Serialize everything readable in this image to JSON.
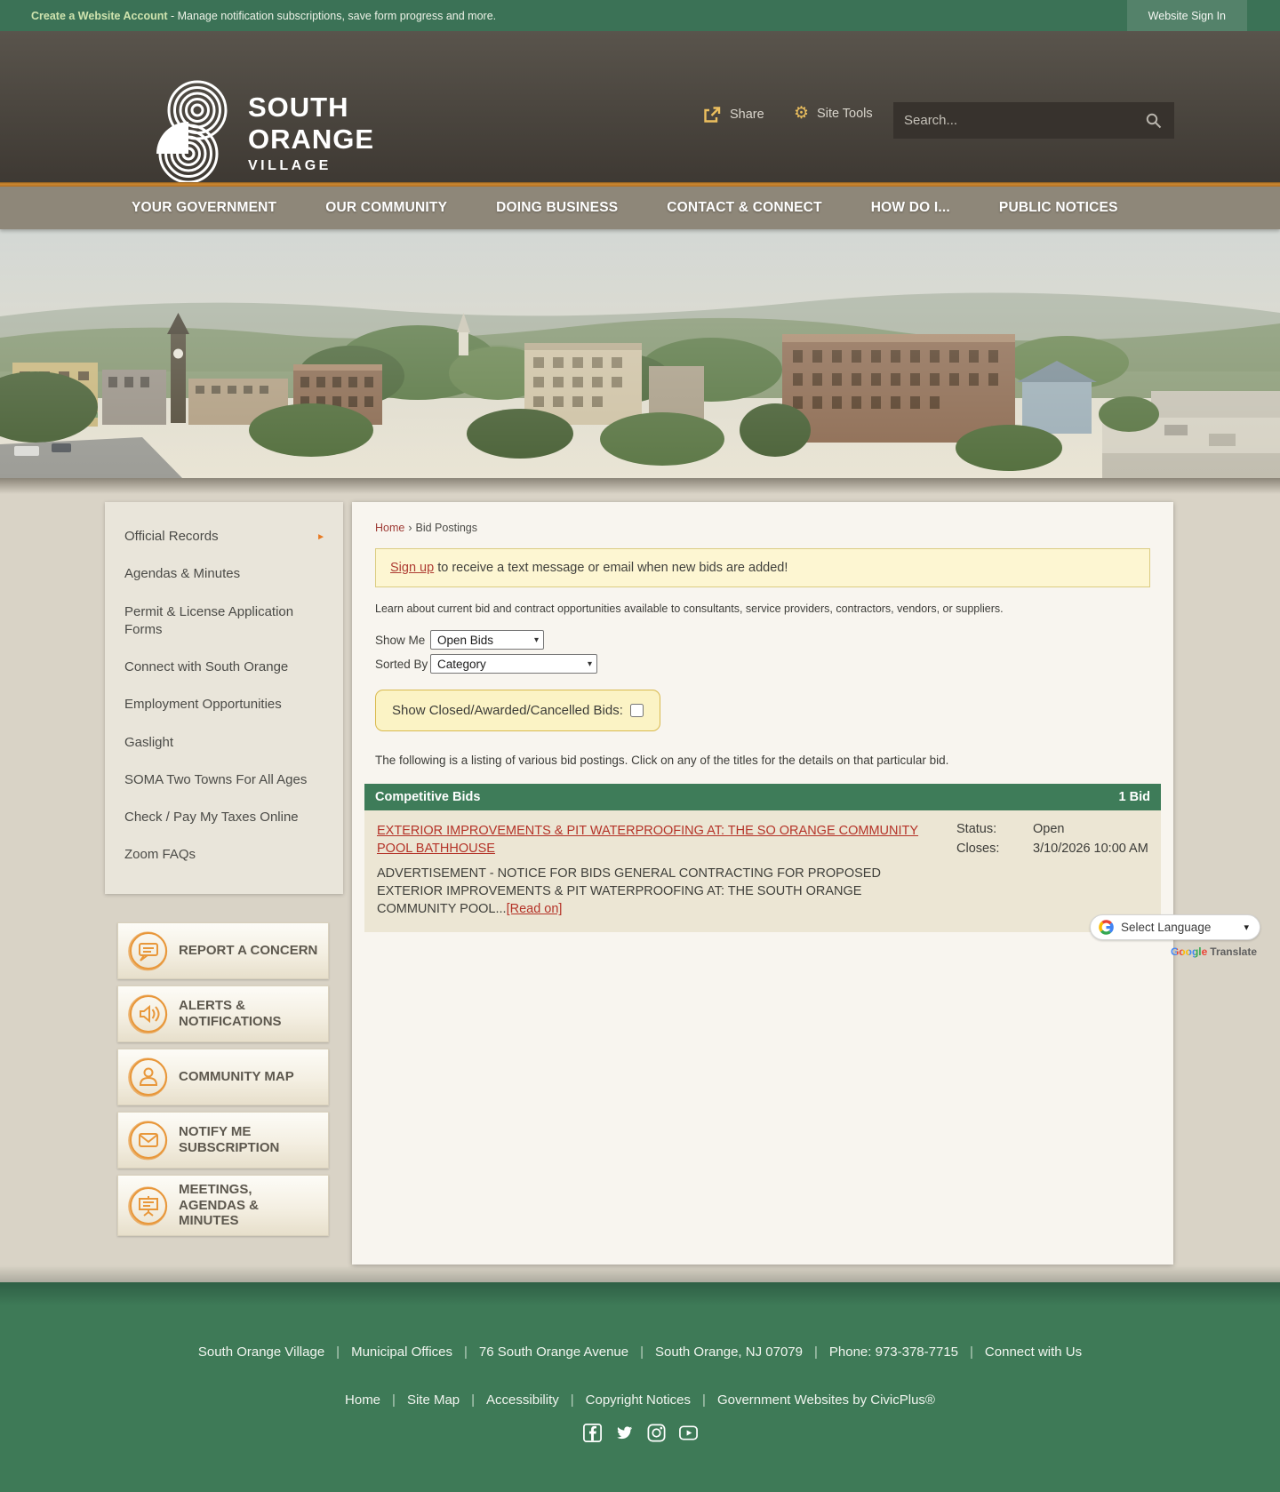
{
  "topbar": {
    "account_bold": "Create a Website Account",
    "account_rest": " - Manage notification subscriptions, save form progress and more.",
    "signin": "Website Sign In"
  },
  "header": {
    "logo_line1": "SOUTH",
    "logo_line2": "ORANGE",
    "logo_line3": "VILLAGE",
    "share": "Share",
    "site_tools": "Site Tools",
    "search_placeholder": "Search...",
    "gear_glyph": "⚙"
  },
  "nav": {
    "items": [
      "YOUR GOVERNMENT",
      "OUR COMMUNITY",
      "DOING BUSINESS",
      "CONTACT & CONNECT",
      "HOW DO I...",
      "PUBLIC NOTICES"
    ]
  },
  "sidebar": {
    "arrow_glyph": "►",
    "items": [
      {
        "label": "Official Records",
        "has_submenu": true
      },
      {
        "label": "Agendas & Minutes"
      },
      {
        "label": "Permit & License Application Forms"
      },
      {
        "label": "Connect with South Orange"
      },
      {
        "label": "Employment Opportunities"
      },
      {
        "label": "Gaslight"
      },
      {
        "label": "SOMA Two Towns For All Ages"
      },
      {
        "label": "Check / Pay My Taxes Online"
      },
      {
        "label": "Zoom FAQs"
      }
    ]
  },
  "quick_buttons": [
    {
      "label": "REPORT A CONCERN",
      "icon": "speech-bubble-icon"
    },
    {
      "label": "ALERTS & NOTIFICATIONS",
      "icon": "speaker-icon"
    },
    {
      "label": "COMMUNITY MAP",
      "icon": "person-icon"
    },
    {
      "label": "NOTIFY ME SUBSCRIPTION",
      "icon": "envelope-icon"
    },
    {
      "label": "MEETINGS, AGENDAS & MINUTES",
      "icon": "presentation-icon"
    }
  ],
  "main": {
    "breadcrumb": {
      "home": "Home",
      "separator": "›",
      "current": "Bid Postings"
    },
    "signup": {
      "link": "Sign up",
      "rest": " to receive a text message or email when new bids are added!"
    },
    "intro": "Learn about current bid and contract opportunities available to consultants, service providers, contractors, vendors, or suppliers.",
    "filters": {
      "show_me_label": "Show Me",
      "show_me_value": "Open Bids",
      "sorted_by_label": "Sorted By",
      "sorted_by_value": "Category",
      "chevron": "▾"
    },
    "toggle_label": "Show Closed/Awarded/Cancelled Bids:",
    "listing_note": "The following is a listing of various bid postings. Click on any of the titles for the details on that particular bid.",
    "category": {
      "name": "Competitive Bids",
      "count": "1 Bid"
    },
    "bid": {
      "title": "EXTERIOR IMPROVEMENTS & PIT WATERPROOFING AT: THE SO ORANGE COMMUNITY POOL BATHHOUSE",
      "status_label": "Status:",
      "status_value": "Open",
      "closes_label": "Closes:",
      "closes_value": "3/10/2026 10:00 AM",
      "description": "ADVERTISEMENT - NOTICE FOR BIDS GENERAL CONTRACTING FOR PROPOSED EXTERIOR IMPROVEMENTS & PIT WATERPROOFING AT: THE SOUTH ORANGE COMMUNITY POOL...",
      "read_on": "[Read on]"
    }
  },
  "translate": {
    "select_label": "Select Language",
    "chevron": "▾",
    "google_word": "Google",
    "translate_word": "Translate"
  },
  "footer": {
    "separator": "|",
    "row1": [
      "South Orange Village",
      "Municipal Offices",
      "76 South Orange Avenue",
      "South Orange, NJ 07079",
      "Phone: 973-378-7715",
      "Connect with Us"
    ],
    "row2": [
      "Home",
      "Site Map",
      "Accessibility",
      "Copyright Notices",
      "Government Websites by CivicPlus®"
    ],
    "social": [
      "facebook",
      "twitter",
      "instagram",
      "youtube"
    ]
  },
  "colors": {
    "brand_green": "#3e7a57",
    "topbar_green": "#3b7256",
    "header_brown": "#4a453e",
    "accent_gold": "#cd8930",
    "nav_gray": "#8e8779",
    "page_beige": "#d9d3c6",
    "panel_cream": "#f8f5ef",
    "bid_row_beige": "#ece6d4",
    "note_yellow": "#fdf6d2",
    "link_red": "#b43328",
    "orange_icon": "#e8973a"
  }
}
